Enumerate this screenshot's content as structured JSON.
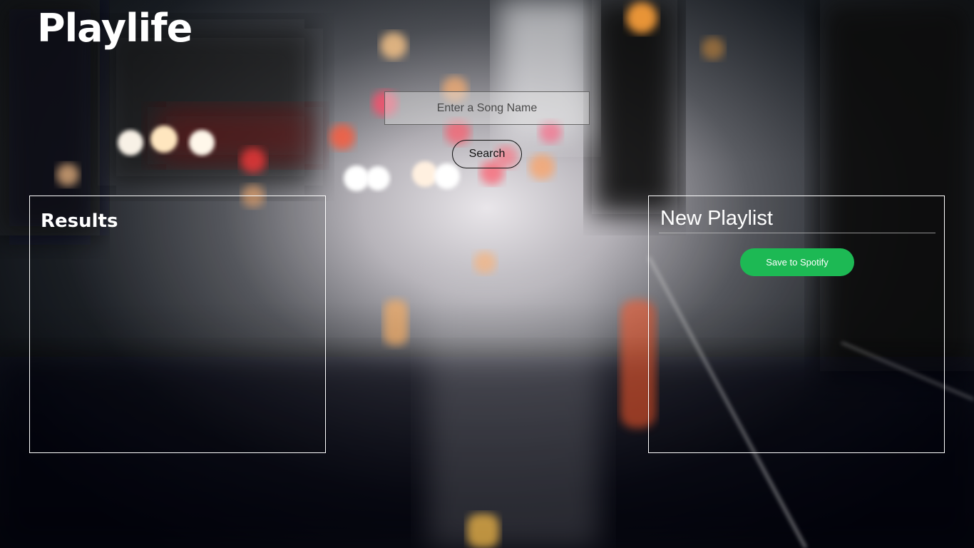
{
  "app": {
    "logo_text": "Playlife"
  },
  "search": {
    "placeholder": "Enter a Song Name",
    "value": "",
    "button_label": "Search"
  },
  "results": {
    "title": "Results",
    "items": []
  },
  "playlist": {
    "name": "New Playlist",
    "save_label": "Save to Spotify",
    "tracks": []
  },
  "colors": {
    "spotify_green": "#1db954",
    "text_white": "#ffffff"
  },
  "background": {
    "description_icon": "rainy-city-street-background"
  }
}
